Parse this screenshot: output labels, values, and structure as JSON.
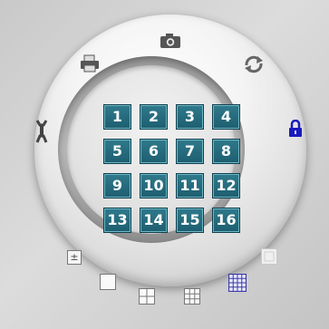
{
  "colors": {
    "tile_fill": "#2a6f80",
    "tile_text": "#ffffff",
    "lock_icon": "#1a1abf",
    "active_layout": "#3a3aa8"
  },
  "icons": {
    "top": "camera-icon",
    "top_left": "print-icon",
    "top_right": "refresh-icon",
    "left": "tools-icon",
    "right": "lock-icon",
    "bottom_left_small": "plus-minus-icon",
    "layouts": [
      "layout-1-icon",
      "layout-4-icon",
      "layout-9-icon",
      "layout-16-icon",
      "layout-disabled-icon"
    ]
  },
  "channels": [
    "1",
    "2",
    "3",
    "4",
    "5",
    "6",
    "7",
    "8",
    "9",
    "10",
    "11",
    "12",
    "13",
    "14",
    "15",
    "16"
  ],
  "zoom_label": "±",
  "active_layout_index": 3
}
